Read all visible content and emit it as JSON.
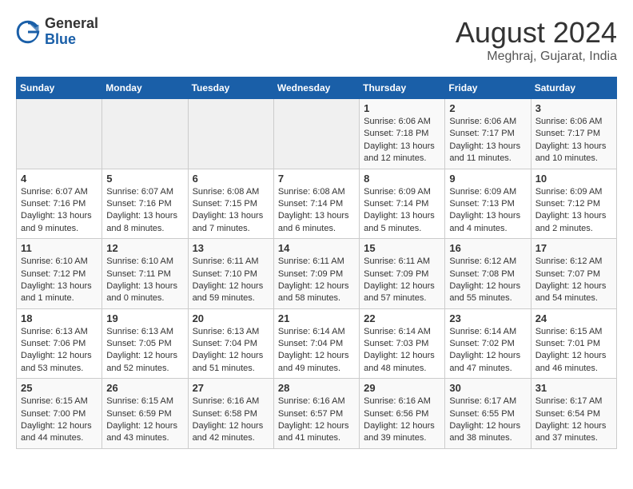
{
  "header": {
    "logo": {
      "general": "General",
      "blue": "Blue"
    },
    "title": "August 2024",
    "location": "Meghraj, Gujarat, India"
  },
  "calendar": {
    "days_of_week": [
      "Sunday",
      "Monday",
      "Tuesday",
      "Wednesday",
      "Thursday",
      "Friday",
      "Saturday"
    ],
    "weeks": [
      [
        {
          "day": "",
          "info": ""
        },
        {
          "day": "",
          "info": ""
        },
        {
          "day": "",
          "info": ""
        },
        {
          "day": "",
          "info": ""
        },
        {
          "day": "1",
          "info": "Sunrise: 6:06 AM\nSunset: 7:18 PM\nDaylight: 13 hours and 12 minutes."
        },
        {
          "day": "2",
          "info": "Sunrise: 6:06 AM\nSunset: 7:17 PM\nDaylight: 13 hours and 11 minutes."
        },
        {
          "day": "3",
          "info": "Sunrise: 6:06 AM\nSunset: 7:17 PM\nDaylight: 13 hours and 10 minutes."
        }
      ],
      [
        {
          "day": "4",
          "info": "Sunrise: 6:07 AM\nSunset: 7:16 PM\nDaylight: 13 hours and 9 minutes."
        },
        {
          "day": "5",
          "info": "Sunrise: 6:07 AM\nSunset: 7:16 PM\nDaylight: 13 hours and 8 minutes."
        },
        {
          "day": "6",
          "info": "Sunrise: 6:08 AM\nSunset: 7:15 PM\nDaylight: 13 hours and 7 minutes."
        },
        {
          "day": "7",
          "info": "Sunrise: 6:08 AM\nSunset: 7:14 PM\nDaylight: 13 hours and 6 minutes."
        },
        {
          "day": "8",
          "info": "Sunrise: 6:09 AM\nSunset: 7:14 PM\nDaylight: 13 hours and 5 minutes."
        },
        {
          "day": "9",
          "info": "Sunrise: 6:09 AM\nSunset: 7:13 PM\nDaylight: 13 hours and 4 minutes."
        },
        {
          "day": "10",
          "info": "Sunrise: 6:09 AM\nSunset: 7:12 PM\nDaylight: 13 hours and 2 minutes."
        }
      ],
      [
        {
          "day": "11",
          "info": "Sunrise: 6:10 AM\nSunset: 7:12 PM\nDaylight: 13 hours and 1 minute."
        },
        {
          "day": "12",
          "info": "Sunrise: 6:10 AM\nSunset: 7:11 PM\nDaylight: 13 hours and 0 minutes."
        },
        {
          "day": "13",
          "info": "Sunrise: 6:11 AM\nSunset: 7:10 PM\nDaylight: 12 hours and 59 minutes."
        },
        {
          "day": "14",
          "info": "Sunrise: 6:11 AM\nSunset: 7:09 PM\nDaylight: 12 hours and 58 minutes."
        },
        {
          "day": "15",
          "info": "Sunrise: 6:11 AM\nSunset: 7:09 PM\nDaylight: 12 hours and 57 minutes."
        },
        {
          "day": "16",
          "info": "Sunrise: 6:12 AM\nSunset: 7:08 PM\nDaylight: 12 hours and 55 minutes."
        },
        {
          "day": "17",
          "info": "Sunrise: 6:12 AM\nSunset: 7:07 PM\nDaylight: 12 hours and 54 minutes."
        }
      ],
      [
        {
          "day": "18",
          "info": "Sunrise: 6:13 AM\nSunset: 7:06 PM\nDaylight: 12 hours and 53 minutes."
        },
        {
          "day": "19",
          "info": "Sunrise: 6:13 AM\nSunset: 7:05 PM\nDaylight: 12 hours and 52 minutes."
        },
        {
          "day": "20",
          "info": "Sunrise: 6:13 AM\nSunset: 7:04 PM\nDaylight: 12 hours and 51 minutes."
        },
        {
          "day": "21",
          "info": "Sunrise: 6:14 AM\nSunset: 7:04 PM\nDaylight: 12 hours and 49 minutes."
        },
        {
          "day": "22",
          "info": "Sunrise: 6:14 AM\nSunset: 7:03 PM\nDaylight: 12 hours and 48 minutes."
        },
        {
          "day": "23",
          "info": "Sunrise: 6:14 AM\nSunset: 7:02 PM\nDaylight: 12 hours and 47 minutes."
        },
        {
          "day": "24",
          "info": "Sunrise: 6:15 AM\nSunset: 7:01 PM\nDaylight: 12 hours and 46 minutes."
        }
      ],
      [
        {
          "day": "25",
          "info": "Sunrise: 6:15 AM\nSunset: 7:00 PM\nDaylight: 12 hours and 44 minutes."
        },
        {
          "day": "26",
          "info": "Sunrise: 6:15 AM\nSunset: 6:59 PM\nDaylight: 12 hours and 43 minutes."
        },
        {
          "day": "27",
          "info": "Sunrise: 6:16 AM\nSunset: 6:58 PM\nDaylight: 12 hours and 42 minutes."
        },
        {
          "day": "28",
          "info": "Sunrise: 6:16 AM\nSunset: 6:57 PM\nDaylight: 12 hours and 41 minutes."
        },
        {
          "day": "29",
          "info": "Sunrise: 6:16 AM\nSunset: 6:56 PM\nDaylight: 12 hours and 39 minutes."
        },
        {
          "day": "30",
          "info": "Sunrise: 6:17 AM\nSunset: 6:55 PM\nDaylight: 12 hours and 38 minutes."
        },
        {
          "day": "31",
          "info": "Sunrise: 6:17 AM\nSunset: 6:54 PM\nDaylight: 12 hours and 37 minutes."
        }
      ]
    ]
  }
}
